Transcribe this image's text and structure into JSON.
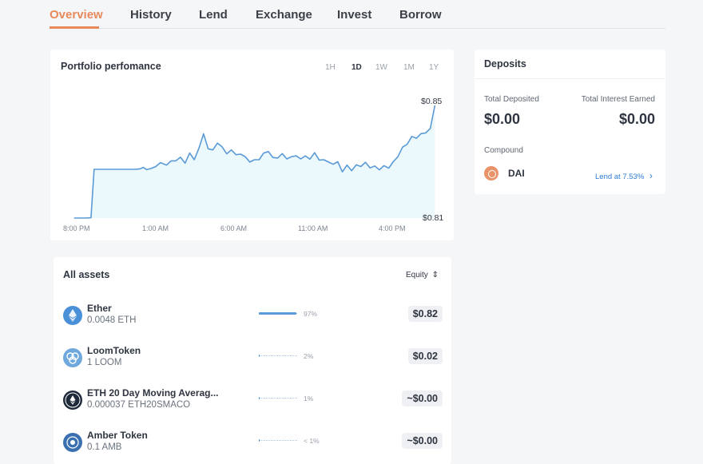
{
  "nav": {
    "tabs": [
      {
        "label": "Overview",
        "active": true
      },
      {
        "label": "History",
        "active": false
      },
      {
        "label": "Lend",
        "active": false
      },
      {
        "label": "Exchange",
        "active": false
      },
      {
        "label": "Invest",
        "active": false
      },
      {
        "label": "Borrow",
        "active": false
      }
    ]
  },
  "colors": {
    "accent": "#e8895c",
    "line": "#5a9ad6",
    "area": "#ebf8fc",
    "link": "#2e7bd6"
  },
  "portfolio": {
    "title": "Portfolio perfomance",
    "ranges": [
      "1H",
      "1D",
      "1W",
      "1M",
      "1Y"
    ],
    "active_range": "1D",
    "high_label": "$0.85",
    "low_label": "$0.81",
    "time_labels": [
      "8:00 PM",
      "1:00 AM",
      "6:00 AM",
      "11:00 AM",
      "4:00 PM"
    ]
  },
  "chart_data": {
    "type": "area",
    "title": "Portfolio perfomance",
    "x": [
      0,
      0.4,
      0.8,
      1.1,
      1.3,
      2,
      3,
      4,
      4.3,
      4.5,
      4.7,
      5,
      5.3,
      5.6,
      6,
      6.3,
      6.6,
      6.9,
      7.2,
      7.5,
      7.8,
      8.1,
      8.4,
      8.7,
      9,
      9.3,
      9.6,
      9.9,
      10.2,
      10.5,
      10.8,
      11.1,
      11.4,
      11.7,
      12,
      12.3,
      12.6,
      12.9,
      13.2,
      13.5,
      13.8,
      14.1,
      14.4,
      14.7,
      15,
      15.3,
      15.6,
      15.9,
      16.2,
      16.5,
      16.8,
      17.1,
      17.4,
      17.7,
      18,
      18.3,
      18.6,
      18.9,
      19.2,
      19.5,
      19.8,
      20.1,
      20.4,
      20.7,
      21,
      21.3,
      21.6,
      21.9,
      22.2,
      22.5,
      22.8,
      23.1,
      23.4
    ],
    "values": [
      0.81,
      0.81,
      0.81,
      0.8101,
      0.8273,
      0.8273,
      0.8273,
      0.8273,
      0.8275,
      0.828,
      0.8272,
      0.8276,
      0.8283,
      0.8297,
      0.8288,
      0.8303,
      0.8303,
      0.8316,
      0.8295,
      0.8331,
      0.8307,
      0.8348,
      0.8399,
      0.8346,
      0.8342,
      0.8366,
      0.8353,
      0.8328,
      0.8342,
      0.8325,
      0.8327,
      0.8318,
      0.8299,
      0.8307,
      0.8307,
      0.8331,
      0.8336,
      0.8315,
      0.8313,
      0.8329,
      0.831,
      0.8318,
      0.8321,
      0.831,
      0.8321,
      0.8309,
      0.8332,
      0.8306,
      0.8307,
      0.8299,
      0.8291,
      0.83,
      0.8264,
      0.8288,
      0.8268,
      0.8289,
      0.8283,
      0.8298,
      0.8278,
      0.8285,
      0.8271,
      0.8286,
      0.8277,
      0.83,
      0.8318,
      0.8352,
      0.8362,
      0.839,
      0.8383,
      0.84,
      0.8402,
      0.8418,
      0.85
    ],
    "xlabel": "",
    "ylabel": "",
    "x_tick_labels": [
      "8:00 PM",
      "1:00 AM",
      "6:00 AM",
      "11:00 AM",
      "4:00 PM"
    ],
    "x_tick_positions": [
      0,
      5,
      10,
      15,
      20
    ],
    "xlim": [
      -0.5,
      24.0
    ],
    "ylim": [
      0.81,
      0.85
    ],
    "annotations": [
      "$0.85",
      "$0.81"
    ],
    "grid": false
  },
  "deposits": {
    "title": "Deposits",
    "total_deposited_label": "Total Deposited",
    "total_deposited_value": "$0.00",
    "total_interest_label": "Total Interest Earned",
    "total_interest_value": "$0.00",
    "protocol_label": "Compound",
    "asset_name": "DAI",
    "asset_icon": "dai-icon",
    "lend_label": "Lend at 7.53%",
    "lend_arrow": "›"
  },
  "assets": {
    "title": "All assets",
    "sort_label": "Equity",
    "sort_icon": "⇕",
    "rows": [
      {
        "name": "Ether",
        "amount": "0.0048 ETH",
        "pct_label": "97%",
        "share": 0.97,
        "equity": "$0.82",
        "icon": "ether-icon",
        "color": "#4a90d9"
      },
      {
        "name": "LoomToken",
        "amount": "1 LOOM",
        "pct_label": "2%",
        "share": 0.02,
        "equity": "$0.02",
        "icon": "loom-icon",
        "color": "#6fa8dc"
      },
      {
        "name": "ETH 20 Day Moving Averag...",
        "amount": "0.000037 ETH20SMACO",
        "pct_label": "1%",
        "share": 0.01,
        "equity": "~$0.00",
        "icon": "eth20-icon",
        "color": "#1e2a3a"
      },
      {
        "name": "Amber Token",
        "amount": "0.1 AMB",
        "pct_label": "< 1%",
        "share": 0.005,
        "equity": "~$0.00",
        "icon": "amber-icon",
        "color": "#3a6fb0"
      }
    ]
  }
}
